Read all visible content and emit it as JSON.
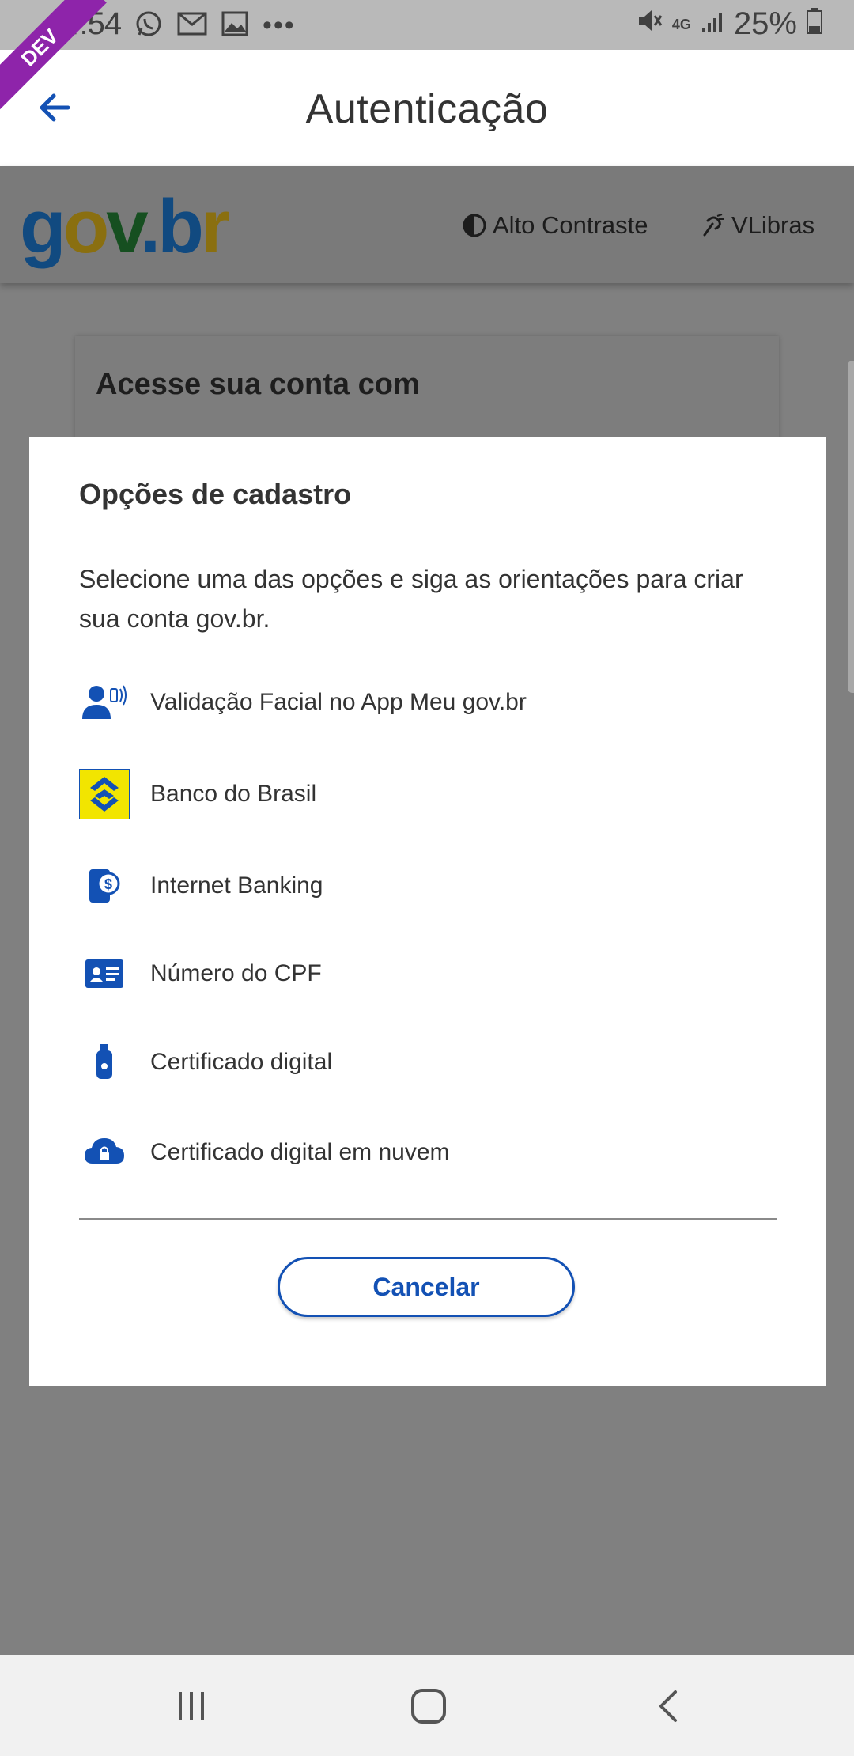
{
  "status_bar": {
    "time": "14:54",
    "battery": "25%",
    "network": "4G",
    "dev_badge": "DEV"
  },
  "appbar": {
    "title": "Autenticação"
  },
  "header": {
    "logo": {
      "g": "g",
      "o": "o",
      "v": "v",
      "dot": ".",
      "b": "b",
      "r": "r"
    },
    "contrast_label": "Alto Contraste",
    "vlibras_label": "VLibras"
  },
  "background_card": {
    "title": "Acesse sua conta com"
  },
  "modal": {
    "title": "Opções de cadastro",
    "description": "Selecione uma das opções e siga as orientações para criar sua conta gov.br.",
    "options": [
      {
        "label": "Validação Facial no App Meu gov.br",
        "icon": "face-validation-icon"
      },
      {
        "label": "Banco do Brasil",
        "icon": "banco-do-brasil-icon"
      },
      {
        "label": "Internet Banking",
        "icon": "internet-banking-icon"
      },
      {
        "label": "Número do CPF",
        "icon": "id-card-icon"
      },
      {
        "label": "Certificado digital",
        "icon": "usb-token-icon"
      },
      {
        "label": "Certificado digital em nuvem",
        "icon": "cloud-lock-icon"
      }
    ],
    "cancel_label": "Cancelar"
  },
  "colors": {
    "accent": "#1351b4",
    "status_bar": "#b9b9b9",
    "overlay": "#808080",
    "dev_ribbon": "#8e24aa",
    "bb_yellow": "#f2e500"
  }
}
